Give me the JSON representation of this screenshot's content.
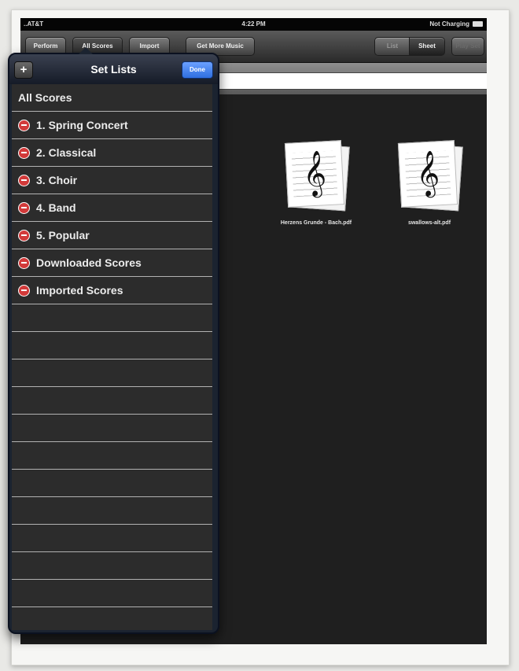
{
  "status": {
    "carrier": "..AT&T",
    "time": "4:22 PM",
    "battery_text": "Not Charging"
  },
  "toolbar": {
    "perform": "Perform",
    "all_scores": "All Scores",
    "import": "Import",
    "get_more_music": "Get More Music",
    "list": "List",
    "sheet": "Sheet",
    "play_set": "Play Set"
  },
  "files": [
    {
      "name": "Herzens Grunde - Bach.pdf"
    },
    {
      "name": "swallows-alt.pdf"
    }
  ],
  "popover": {
    "title": "Set Lists",
    "add_label": "+",
    "done_label": "Done",
    "items": [
      {
        "label": "All Scores",
        "deletable": false
      },
      {
        "label": "1. Spring Concert",
        "deletable": true
      },
      {
        "label": "2. Classical",
        "deletable": true
      },
      {
        "label": "3. Choir",
        "deletable": true
      },
      {
        "label": "4. Band",
        "deletable": true
      },
      {
        "label": "5. Popular",
        "deletable": true
      },
      {
        "label": "Downloaded Scores",
        "deletable": true
      },
      {
        "label": "Imported Scores",
        "deletable": true
      }
    ]
  },
  "icons": {
    "delete": "minus-circle-icon",
    "score": "treble-clef-icon"
  }
}
